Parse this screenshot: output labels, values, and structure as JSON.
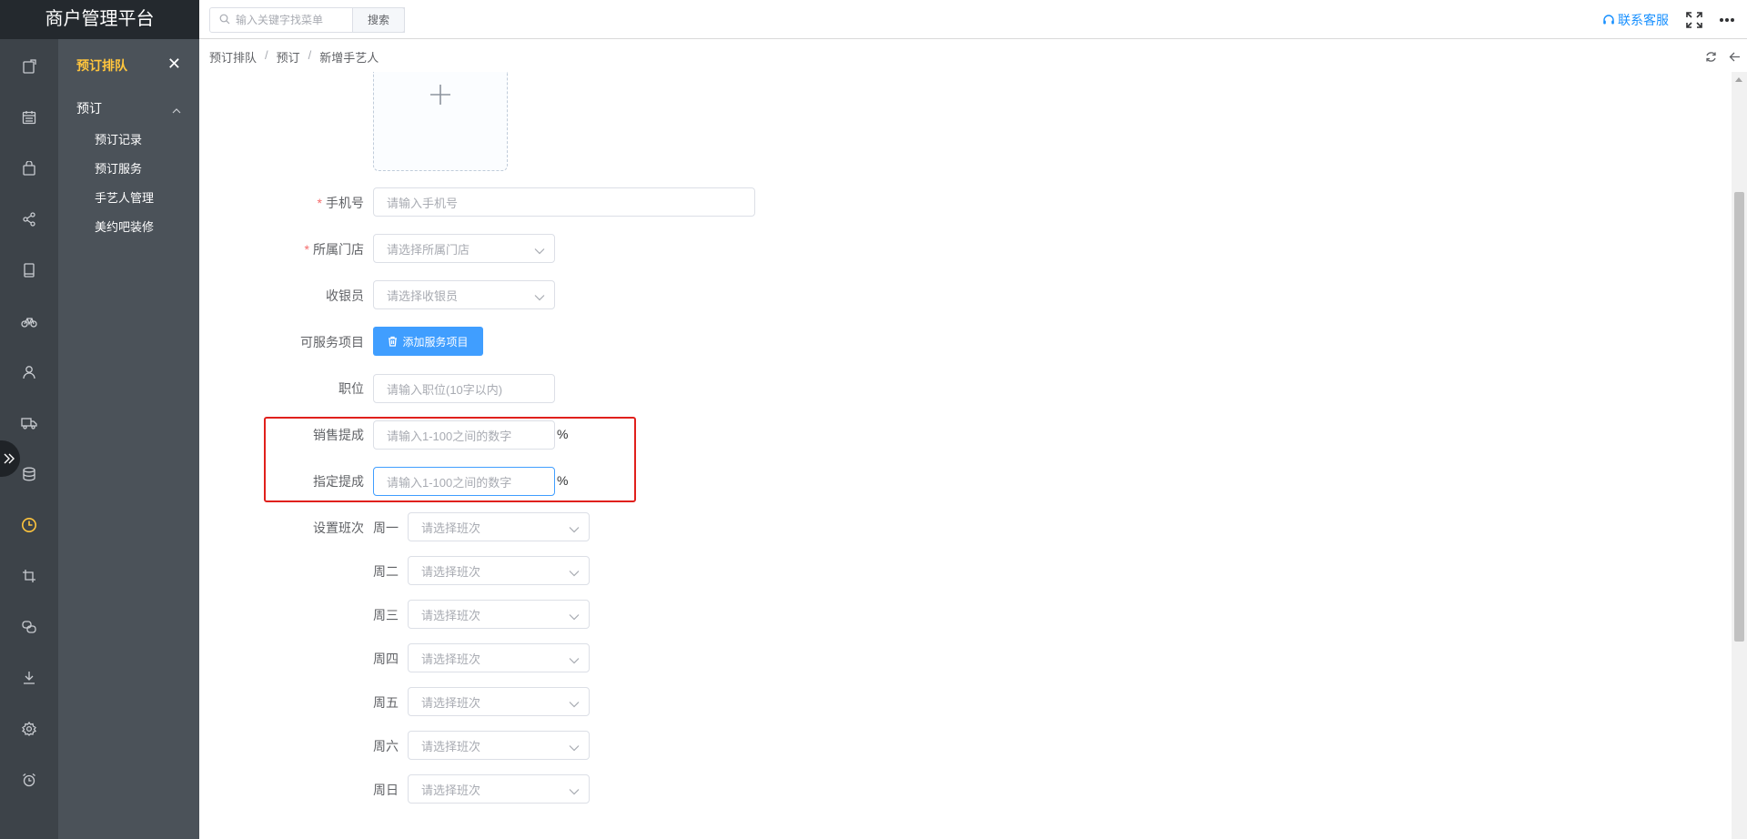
{
  "header": {
    "brand": "商户管理平台",
    "search_placeholder": "输入关键字找菜单",
    "search_button": "搜索",
    "service_label": "联系客服"
  },
  "rail": {
    "icons": [
      "clipboard-icon",
      "calendar-icon",
      "shopping-bag-icon",
      "share-icon",
      "tablet-icon",
      "bicycle-icon",
      "user-icon",
      "truck-icon",
      "database-icon",
      "clock-icon",
      "crop-icon",
      "chat-icon",
      "download-icon",
      "settings-icon",
      "alarm-icon"
    ],
    "active": "clock-icon",
    "active_color": "#ffc53d"
  },
  "submenu": {
    "title": "预订排队",
    "group": "预订",
    "items": [
      "预订记录",
      "预订服务",
      "手艺人管理",
      "美约吧装修"
    ]
  },
  "breadcrumb": [
    "预订排队",
    "预订",
    "新增手艺人"
  ],
  "form": {
    "phone": {
      "label": "手机号",
      "required": true,
      "placeholder": "请输入手机号"
    },
    "store": {
      "label": "所属门店",
      "required": true,
      "placeholder": "请选择所属门店"
    },
    "cashier": {
      "label": "收银员",
      "placeholder": "请选择收银员"
    },
    "services": {
      "label": "可服务项目",
      "button": "添加服务项目"
    },
    "position": {
      "label": "职位",
      "placeholder": "请输入职位(10字以内)"
    },
    "sales_commission": {
      "label": "销售提成",
      "placeholder": "请输入1-100之间的数字",
      "suffix": "%"
    },
    "assigned_commission": {
      "label": "指定提成",
      "placeholder": "请输入1-100之间的数字",
      "suffix": "%"
    },
    "shifts": {
      "label": "设置班次",
      "placeholder": "请选择班次",
      "days": [
        "周一",
        "周二",
        "周三",
        "周四",
        "周五",
        "周六",
        "周日"
      ]
    }
  },
  "colors": {
    "brand_bg": "#24292e",
    "rail_bg": "#3d4349",
    "submenu_bg": "#4b5259",
    "accent": "#409eff",
    "link": "#1890ff",
    "required": "#f56c6c",
    "highlight": "#e0201c"
  }
}
